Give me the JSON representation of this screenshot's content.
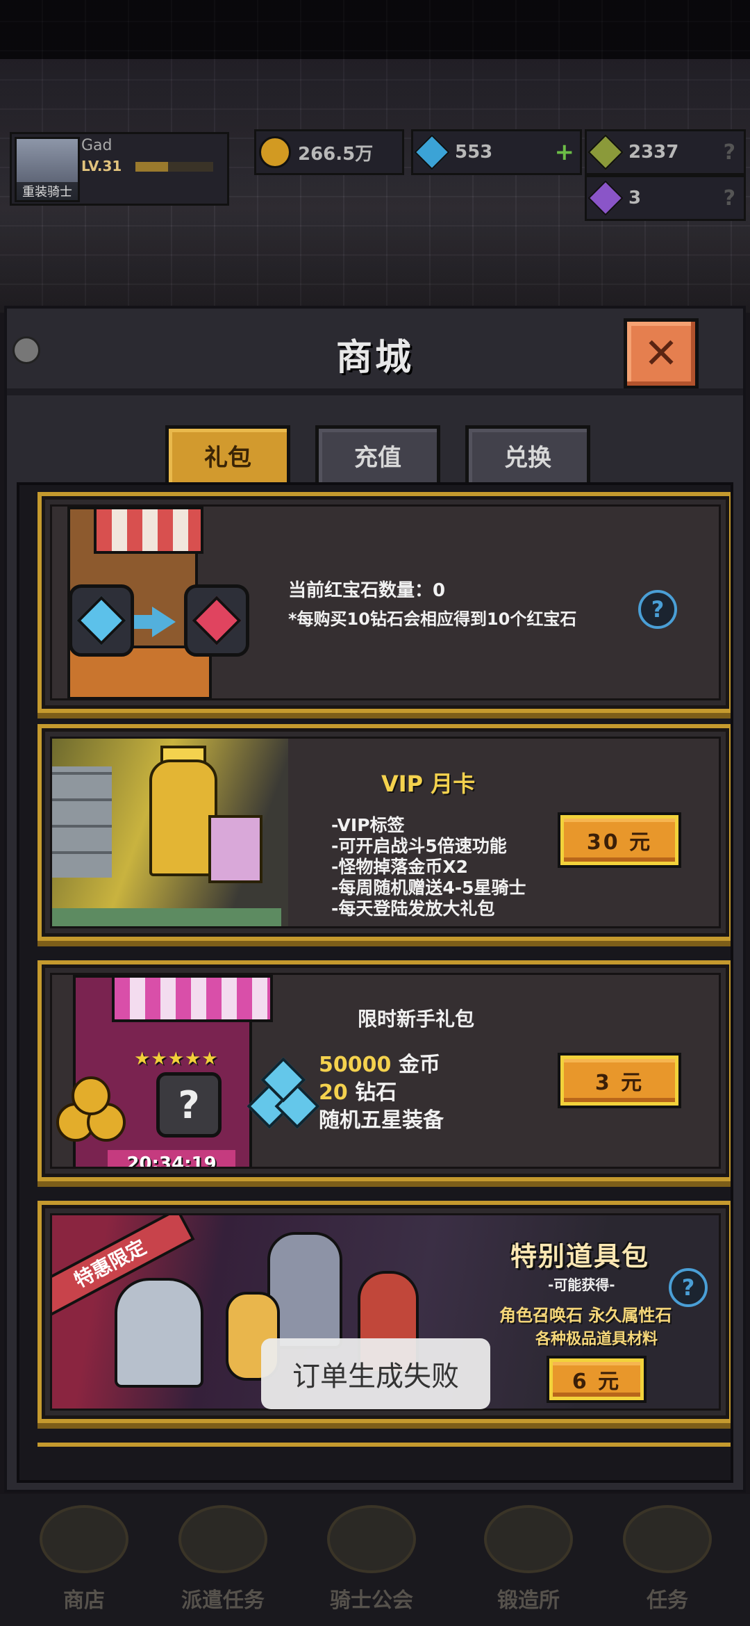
{
  "player": {
    "name": "Gad",
    "level": "LV.31",
    "badge": "重装骑士",
    "level_progress": 0.42
  },
  "resources": [
    {
      "icon": "gold-coin-icon",
      "value": "266.5万"
    },
    {
      "icon": "blue-diamond-icon",
      "value": "553"
    },
    {
      "icon": "green-crystal-icon",
      "value": "2337"
    },
    {
      "icon": "purple-crystal-icon",
      "value": "3"
    }
  ],
  "shop": {
    "title": "商城",
    "close_icon": "close-icon",
    "tabs": [
      {
        "label": "礼包",
        "active": true
      },
      {
        "label": "充值",
        "active": false
      },
      {
        "label": "兑换",
        "active": false
      }
    ]
  },
  "ruby_card": {
    "current_label": "当前红宝石数量：",
    "current_value": "0",
    "note": "*每购买10钻石会相应得到10个红宝石"
  },
  "vip_card": {
    "title": "VIP 月卡",
    "features": [
      "-VIP标签",
      "-可开启战斗5倍速功能",
      "-怪物掉落金币X2",
      "-每周随机赠送4-5星骑士",
      "-每天登陆发放大礼包"
    ],
    "price": "30 元"
  },
  "starter_pack": {
    "title": "限时新手礼包",
    "stars": "★★★★★",
    "items": [
      {
        "amount": "50000",
        "unit": "金币"
      },
      {
        "amount": "20",
        "unit": "钻石"
      },
      {
        "amount": "",
        "unit": "随机五星装备"
      }
    ],
    "timer": "20:34:19",
    "price": "3 元"
  },
  "special_pack": {
    "ribbon": "特惠限定",
    "title": "特别道具包",
    "subtitle": "-可能获得-",
    "line1": "角色召唤石 永久属性石",
    "line2": "各种极品道具材料",
    "price": "6 元"
  },
  "toast": {
    "message": "订单生成失败"
  },
  "bottom_nav": [
    {
      "label": "商店"
    },
    {
      "label": "派遣任务"
    },
    {
      "label": "骑士公会"
    },
    {
      "label": "锻造所"
    },
    {
      "label": "任务"
    }
  ],
  "colors": {
    "accent_gold": "#c59a2e",
    "price_orange": "#e8972b",
    "close_orange": "#e57f4f",
    "gem_blue": "#3ba3d6",
    "ruby_red": "#e0445f"
  }
}
